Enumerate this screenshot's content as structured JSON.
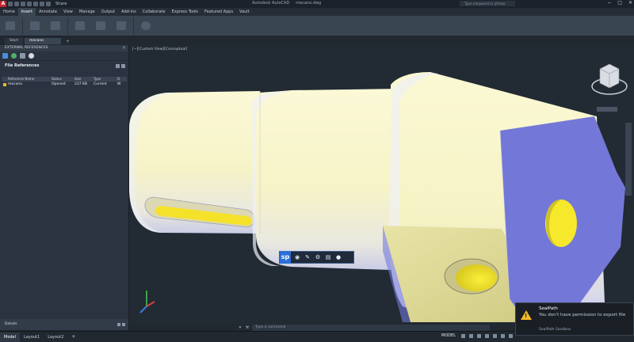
{
  "app": {
    "title": "Autodesk AutoCAD",
    "document": "mecano.dwg",
    "share_label": "Share",
    "search_placeholder": "Type a keyword or phrase"
  },
  "ribbon_tabs": [
    {
      "label": "Home",
      "active": false
    },
    {
      "label": "Insert",
      "active": true
    },
    {
      "label": "Annotate",
      "active": false
    },
    {
      "label": "View",
      "active": false
    },
    {
      "label": "Manage",
      "active": false
    },
    {
      "label": "Output",
      "active": false
    },
    {
      "label": "Add-ins",
      "active": false
    },
    {
      "label": "Collaborate",
      "active": false
    },
    {
      "label": "Express Tools",
      "active": false
    },
    {
      "label": "Featured Apps",
      "active": false
    },
    {
      "label": "Vault",
      "active": false
    }
  ],
  "file_tabs": [
    {
      "label": "Start",
      "active": false
    },
    {
      "label": "mecano",
      "active": true
    }
  ],
  "palette": {
    "title": "EXTERNAL REFERENCES",
    "file_references_label": "File References",
    "columns": [
      "Reference Name",
      "Status",
      "Size",
      "Type",
      "D"
    ],
    "rows": [
      {
        "name": "mecano",
        "status": "Opened",
        "size": "237 KB",
        "type": "Current",
        "d": "W"
      }
    ],
    "details_label": "Details"
  },
  "viewport": {
    "label": "[−][Custom View][Conceptual]"
  },
  "command_line": {
    "placeholder": "Type a command"
  },
  "status_bar": {
    "layout_tabs": [
      {
        "label": "Model",
        "active": true
      },
      {
        "label": "Layout1",
        "active": false
      },
      {
        "label": "Layout2",
        "active": false
      },
      {
        "label": "+",
        "active": false
      }
    ],
    "model_indicator": "MODEL"
  },
  "toast": {
    "title": "SealPath",
    "message": "You don't have permission to export file",
    "source": "SealPath Sandbox"
  },
  "sealpath_toolbar": {
    "logo": "sp"
  },
  "colors": {
    "shaft": "#f7f4cc",
    "face": "#7378d8",
    "hole": "#f3e42c",
    "accent": "#2b6fd6",
    "warning": "#f2b928"
  }
}
